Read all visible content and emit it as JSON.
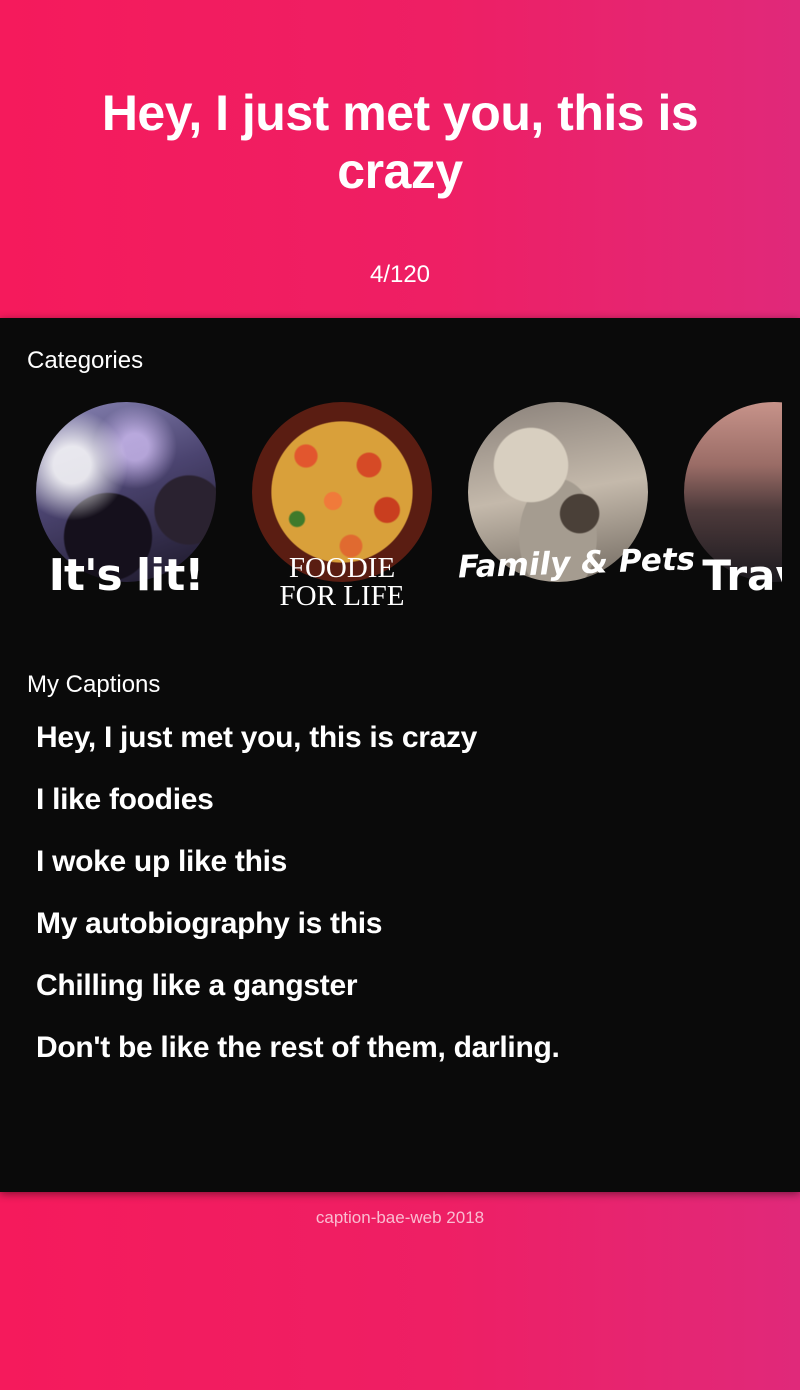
{
  "hero": {
    "caption": "Hey, I just met you, this is crazy",
    "counter": "4/120"
  },
  "categories": {
    "title": "Categories",
    "items": [
      {
        "label": "It's lit!",
        "image": "concert-crowd-photo"
      },
      {
        "label": "FOODIE\nFOR LIFE",
        "image": "paella-dish-photo"
      },
      {
        "label": "Family & Pets",
        "image": "cat-in-blanket-photo"
      },
      {
        "label": "Travel",
        "image": "sea-sunset-photo"
      }
    ]
  },
  "captions": {
    "title": "My Captions",
    "items": [
      "Hey, I just met you, this is crazy",
      "I like foodies",
      "I woke up like this",
      "My autobiography is this",
      "Chilling like a gangster",
      "Don't be like the rest of them, darling."
    ]
  },
  "footer": {
    "text": "caption-bae-web 2018"
  },
  "colors": {
    "gradient_start": "#f51a5c",
    "gradient_end": "#e0297a",
    "panel_background": "#0a0a0a",
    "text": "#ffffff"
  }
}
